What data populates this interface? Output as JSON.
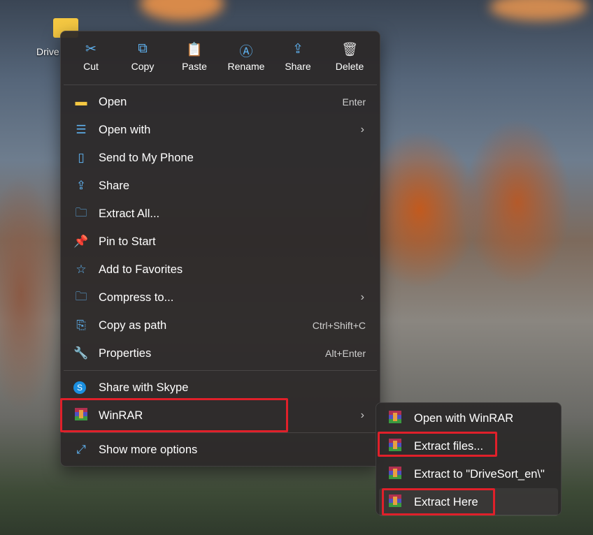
{
  "desktop": {
    "icon_label": "Drive"
  },
  "toolbar": [
    {
      "label": "Cut",
      "icon": "✂"
    },
    {
      "label": "Copy",
      "icon": "⧉"
    },
    {
      "label": "Paste",
      "icon": "📋"
    },
    {
      "label": "Rename",
      "icon": "Ⓐ"
    },
    {
      "label": "Share",
      "icon": "⇪"
    },
    {
      "label": "Delete",
      "icon": "🗑"
    }
  ],
  "items": [
    {
      "label": "Open",
      "shortcut": "Enter",
      "icon": "▬"
    },
    {
      "label": "Open with",
      "icon": "☰",
      "submenu": true
    },
    {
      "label": "Send to My Phone",
      "icon": "▯"
    },
    {
      "label": "Share",
      "icon": "⇪"
    },
    {
      "label": "Extract All...",
      "icon": "🗀"
    },
    {
      "label": "Pin to Start",
      "icon": "📌"
    },
    {
      "label": "Add to Favorites",
      "icon": "☆"
    },
    {
      "label": "Compress to...",
      "icon": "🗀",
      "submenu": true
    },
    {
      "label": "Copy as path",
      "shortcut": "Ctrl+Shift+C",
      "icon": "⎘"
    },
    {
      "label": "Properties",
      "shortcut": "Alt+Enter",
      "icon": "🔧"
    }
  ],
  "items2": [
    {
      "label": "Share with Skype",
      "icon": "S"
    },
    {
      "label": "WinRAR",
      "submenu": true
    }
  ],
  "show_more": {
    "label": "Show more options",
    "icon": "⤢"
  },
  "winrar_submenu": [
    {
      "label": "Open with WinRAR"
    },
    {
      "label": "Extract files..."
    },
    {
      "label": "Extract to \"DriveSort_en\\\""
    },
    {
      "label": "Extract Here"
    }
  ],
  "chevron": "›"
}
